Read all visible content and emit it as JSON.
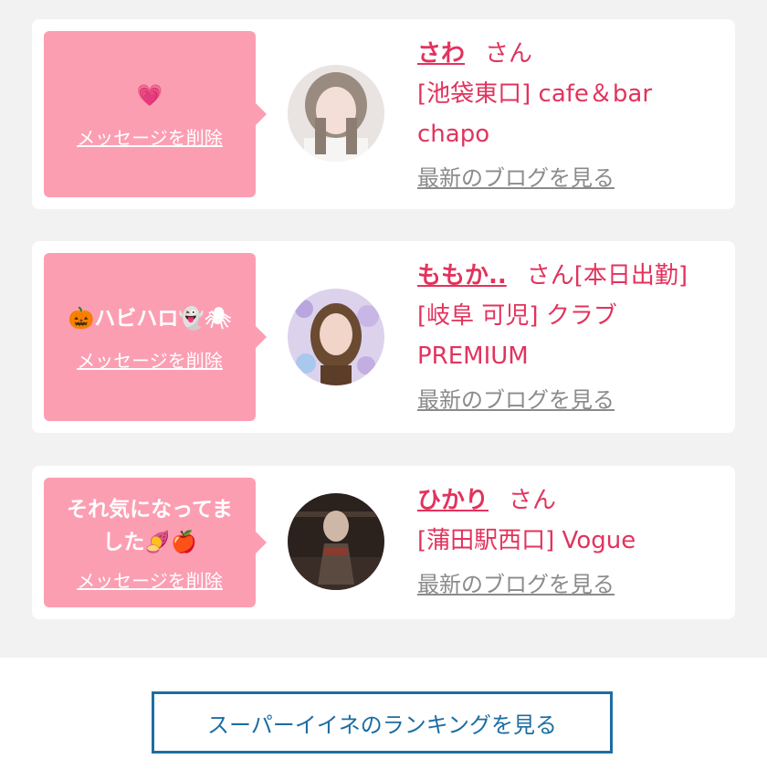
{
  "likes": [
    {
      "message": "💗",
      "delete_label": "メッセージを削除",
      "name": "さわ",
      "suffix": "さん",
      "shop_line1": "[池袋東口] cafe＆bar",
      "shop_line2": "chapo",
      "blog_label": "最新のブログを見る"
    },
    {
      "message": "🎃ハビハロ👻🕷",
      "delete_label": "メッセージを削除",
      "name": "ももか..",
      "suffix": "さん[本日出勤]",
      "shop_line1": "[岐阜 可児] クラブ",
      "shop_line2": "PREMIUM",
      "blog_label": "最新のブログを見る"
    },
    {
      "message_line1": "それ気になってま",
      "message_line2": "した🍠🍎",
      "delete_label": "メッセージを削除",
      "name": "ひかり",
      "suffix": "さん",
      "shop_line1": "[蒲田駅西口] Vogue",
      "blog_label": "最新のブログを見る"
    }
  ],
  "ranking_button_label": "スーパーイイネのランキングを見る"
}
